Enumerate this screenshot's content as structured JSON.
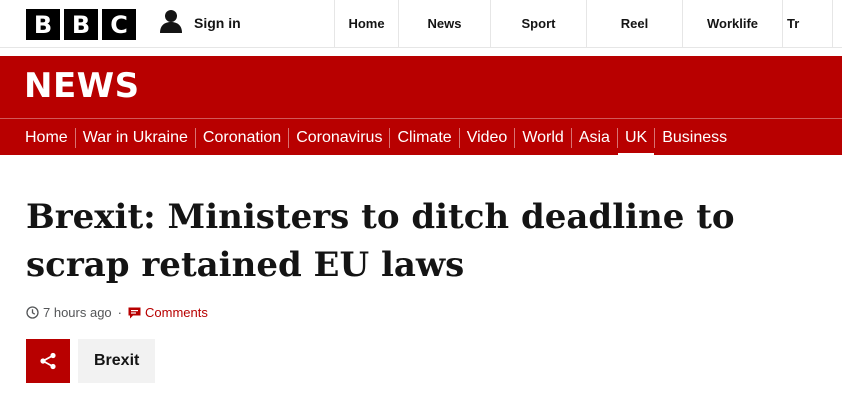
{
  "topbar": {
    "logo_letters": [
      "B",
      "B",
      "C"
    ],
    "sign_in_label": "Sign in",
    "nav_items": [
      "Home",
      "News",
      "Sport",
      "Reel",
      "Worklife",
      "Tr"
    ]
  },
  "news_band": {
    "title": "NEWS",
    "nav_items": [
      "Home",
      "War in Ukraine",
      "Coronation",
      "Coronavirus",
      "Climate",
      "Video",
      "World",
      "Asia",
      "UK",
      "Business"
    ],
    "active_item": "UK"
  },
  "article": {
    "headline_line1": "Brexit: Ministers to ditch deadline to",
    "headline_line2": "scrap retained EU laws",
    "timestamp": "7 hours ago",
    "separator": "·",
    "comments_label": "Comments",
    "tag_label": "Brexit"
  },
  "icons": {
    "user": "user-icon",
    "clock": "clock-icon",
    "comments": "comment-icon",
    "share": "share-icon"
  },
  "colors": {
    "brand_red": "#b80000",
    "text": "#141414",
    "meta_text": "#545658",
    "tag_bg": "#f2f2f2"
  }
}
